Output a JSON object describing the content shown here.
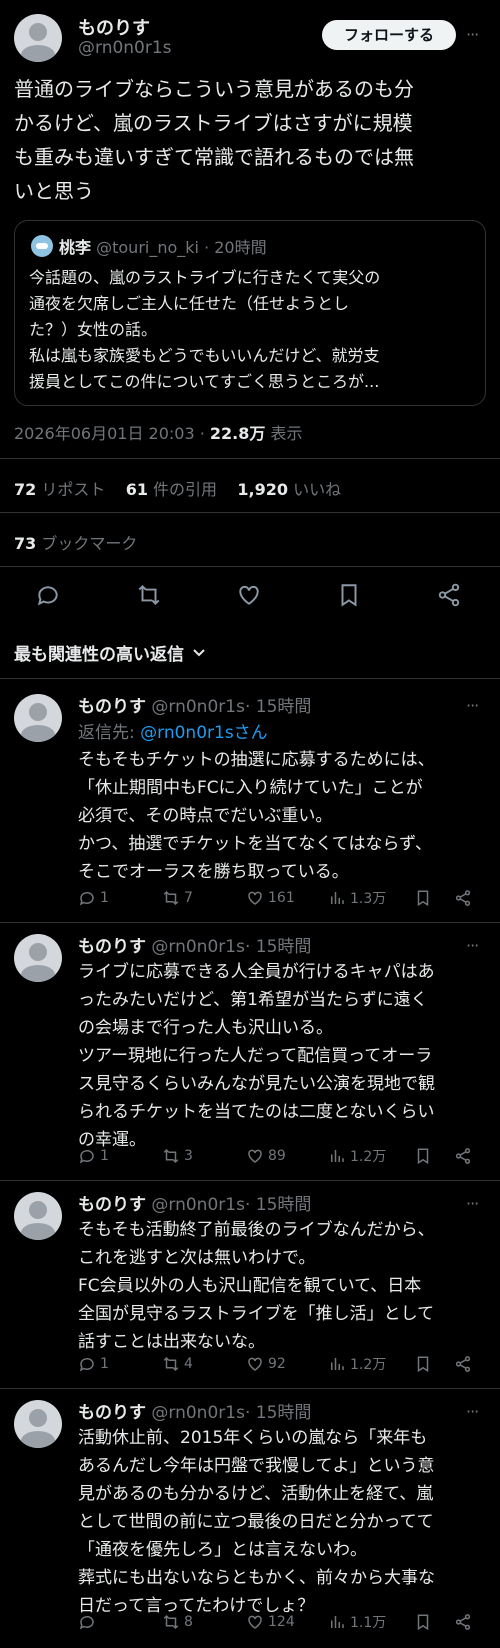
{
  "author": {
    "name": "ものりす",
    "handle": "@rn0n0r1s"
  },
  "follow_label": "フォローする",
  "more_label": "···",
  "tweet": {
    "lines": [
      "普通のライブならこういう意見があるのも分",
      "かるけど、嵐のラストライブはさすがに規模",
      "も重みも違いすぎて常識で語れるものでは無",
      "いと思う"
    ]
  },
  "quote": {
    "name": "桃李",
    "handle": "@touri_no_ki",
    "time": "· 20時間",
    "lines": [
      "今話題の、嵐のラストライブに行きたくて実父の",
      "通夜を欠席しご主人に任せた（任せようとし",
      "た？）女性の話。",
      "私は嵐も家族愛もどうでもいいんだけど、就労支",
      "援員としてこの件についてすごく思うところが..."
    ]
  },
  "meta": {
    "datetime": "2026年06月01日 20:03",
    "sep": " · ",
    "views": "22.8万",
    "views_label": " 表示"
  },
  "stats": {
    "reposts": "72",
    "reposts_label": " リポスト",
    "quotes": "61",
    "quotes_label": " 件の引用",
    "likes": "1,920",
    "likes_label": " いいね",
    "bookmarks": "73",
    "bookmarks_label": " ブックマーク"
  },
  "sort_label": "最も関連性の高い返信",
  "replies": [
    {
      "name": "ものりす",
      "handle": "@rn0n0r1s",
      "time": "· 15時間",
      "reply_to_prefix": "返信先: ",
      "reply_to": "@rn0n0r1sさん",
      "lines": [
        "そもそもチケットの抽選に応募するためには、",
        "「休止期間中もFCに入り続けていた」ことが",
        "必須で、その時点でだいぶ重い。",
        "かつ、抽選でチケットを当てなくてはならず、",
        "そこでオーラスを勝ち取っている。"
      ],
      "replies": "1",
      "reposts": "7",
      "likes": "161",
      "views": "1.3万"
    },
    {
      "name": "ものりす",
      "handle": "@rn0n0r1s",
      "time": "· 15時間",
      "lines": [
        "ライブに応募できる人全員が行けるキャパはあ",
        "ったみたいだけど、第1希望が当たらずに遠く",
        "の会場まで行った人も沢山いる。",
        "ツアー現地に行った人だって配信買ってオーラ",
        "ス見守るくらいみんなが見たい公演を現地で観",
        "られるチケットを当てたのは二度とないくらい",
        "の幸運。"
      ],
      "replies": "1",
      "reposts": "3",
      "likes": "89",
      "views": "1.2万"
    },
    {
      "name": "ものりす",
      "handle": "@rn0n0r1s",
      "time": "· 15時間",
      "lines": [
        "そもそも活動終了前最後のライブなんだから、",
        "これを逃すと次は無いわけで。",
        "FC会員以外の人も沢山配信を観ていて、日本",
        "全国が見守るラストライブを「推し活」として",
        "話すことは出来ないな。"
      ],
      "replies": "1",
      "reposts": "4",
      "likes": "92",
      "views": "1.2万"
    },
    {
      "name": "ものりす",
      "handle": "@rn0n0r1s",
      "time": "· 15時間",
      "lines": [
        "活動休止前、2015年くらいの嵐なら「来年も",
        "あるんだし今年は円盤で我慢してよ」という意",
        "見があるのも分かるけど、活動休止を経て、嵐",
        "として世間の前に立つ最後の日だと分かってて",
        "「通夜を優先しろ」とは言えないわ。",
        "葬式にも出ないならともかく、前々から大事な",
        "日だって言ってたわけでしょ？"
      ],
      "replies": "",
      "reposts": "8",
      "likes": "124",
      "views": "1.1万"
    }
  ],
  "colors": {
    "background": "#000000",
    "text": "#e7e9ea",
    "muted": "#71767b",
    "link": "#1d9bf0",
    "divider": "#2f3336"
  }
}
